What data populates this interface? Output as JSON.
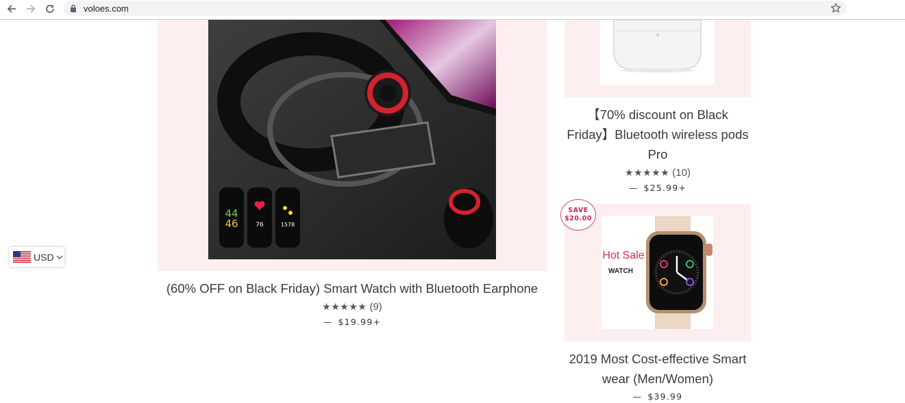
{
  "browser": {
    "url": "voloes.com"
  },
  "currency": {
    "selected": "USD",
    "flag": "us-flag-icon"
  },
  "products": [
    {
      "title": "(60% OFF on Black Friday) Smart Watch with Bluetooth Earphone",
      "rating_count": "(9)",
      "price": "$19.99",
      "price_suffix": "+",
      "watch_readings": [
        "44",
        "46",
        "76",
        "1578"
      ]
    },
    {
      "title_line1": "【70% discount on Black",
      "title_line2": "Friday】Bluetooth wireless pods",
      "title_line3": "Pro",
      "rating_count": "(10)",
      "price": "$25.99",
      "price_suffix": "+"
    },
    {
      "badge_line1": "SAVE",
      "badge_line2": "$20.00",
      "image_text1": "Hot Sale",
      "image_text2": "WATCH",
      "title_line1": "2019 Most Cost-effective Smart",
      "title_line2": "wear (Men/Women)",
      "price": "$39.99"
    }
  ],
  "colors": {
    "card_bg": "#fdeef0",
    "badge": "#c8275a",
    "text": "#3a3a3a"
  }
}
